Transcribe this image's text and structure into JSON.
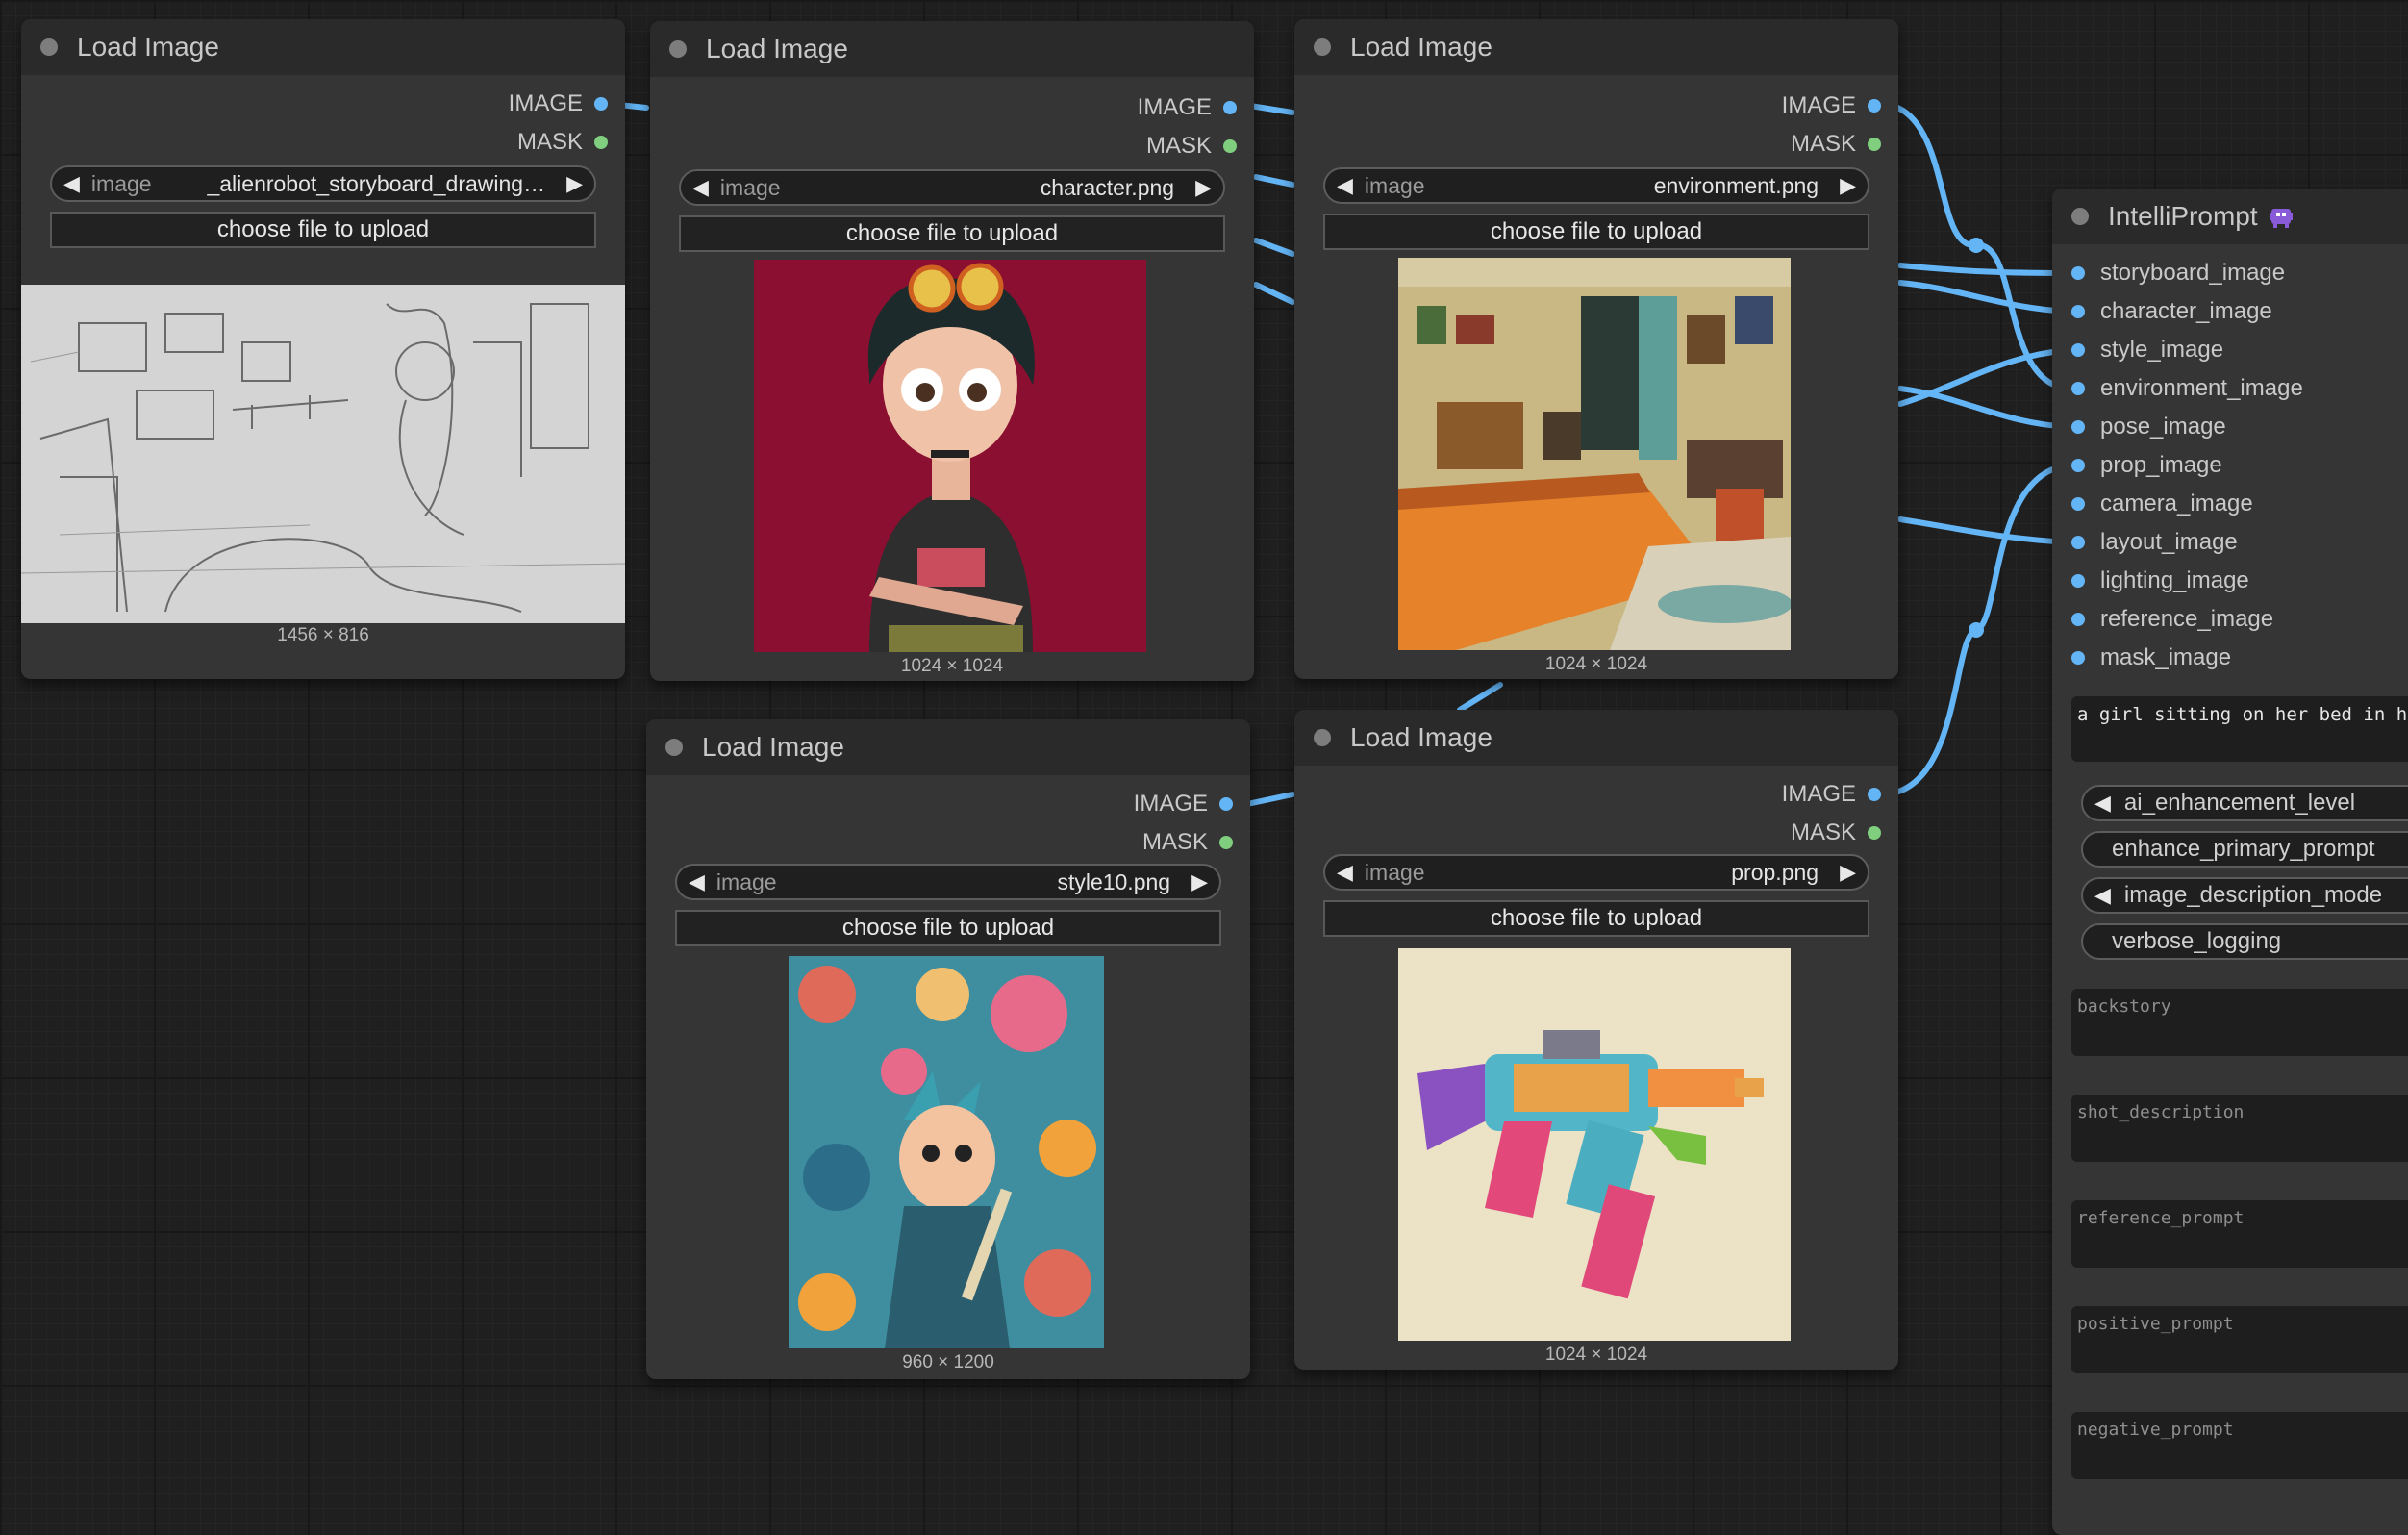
{
  "load_nodes": [
    {
      "title": "Load Image",
      "out_image": "IMAGE",
      "out_mask": "MASK",
      "widget_label": "image",
      "filename": "_alienrobot_storyboard_drawing…",
      "upload_label": "choose file to upload",
      "dims": "1456 × 816",
      "preview": "storyboard sketch"
    },
    {
      "title": "Load Image",
      "out_image": "IMAGE",
      "out_mask": "MASK",
      "widget_label": "image",
      "filename": "character.png",
      "upload_label": "choose file to upload",
      "dims": "1024 × 1024",
      "preview": "character"
    },
    {
      "title": "Load Image",
      "out_image": "IMAGE",
      "out_mask": "MASK",
      "widget_label": "image",
      "filename": "environment.png",
      "upload_label": "choose file to upload",
      "dims": "1024 × 1024",
      "preview": "bedroom environment"
    },
    {
      "title": "Load Image",
      "out_image": "IMAGE",
      "out_mask": "MASK",
      "widget_label": "image",
      "filename": "style10.png",
      "upload_label": "choose file to upload",
      "dims": "960 × 1200",
      "preview": "style illustration"
    },
    {
      "title": "Load Image",
      "out_image": "IMAGE",
      "out_mask": "MASK",
      "widget_label": "image",
      "filename": "prop.png",
      "upload_label": "choose file to upload",
      "dims": "1024 × 1024",
      "preview": "toy gun prop"
    }
  ],
  "intelliprompt": {
    "title": "IntelliPrompt",
    "icon": "alien-monster-icon",
    "inputs": [
      "storyboard_image",
      "character_image",
      "style_image",
      "environment_image",
      "pose_image",
      "prop_image",
      "camera_image",
      "layout_image",
      "lighting_image",
      "reference_image",
      "mask_image"
    ],
    "prompt_text": "a girl sitting on her bed in her",
    "widgets": [
      {
        "label": "ai_enhancement_level",
        "arrow": true
      },
      {
        "label": "enhance_primary_prompt",
        "arrow": false
      },
      {
        "label": "image_description_mode",
        "arrow": true
      },
      {
        "label": "verbose_logging",
        "arrow": false
      }
    ],
    "text_fields": [
      "backstory",
      "shot_description",
      "reference_prompt",
      "positive_prompt",
      "negative_prompt"
    ]
  },
  "colors": {
    "image_socket": "#64b5f6",
    "mask_socket": "#7fcf7f",
    "link": "#64b5f6",
    "node_bg": "#353535",
    "header_bg": "#2a2a2a"
  }
}
